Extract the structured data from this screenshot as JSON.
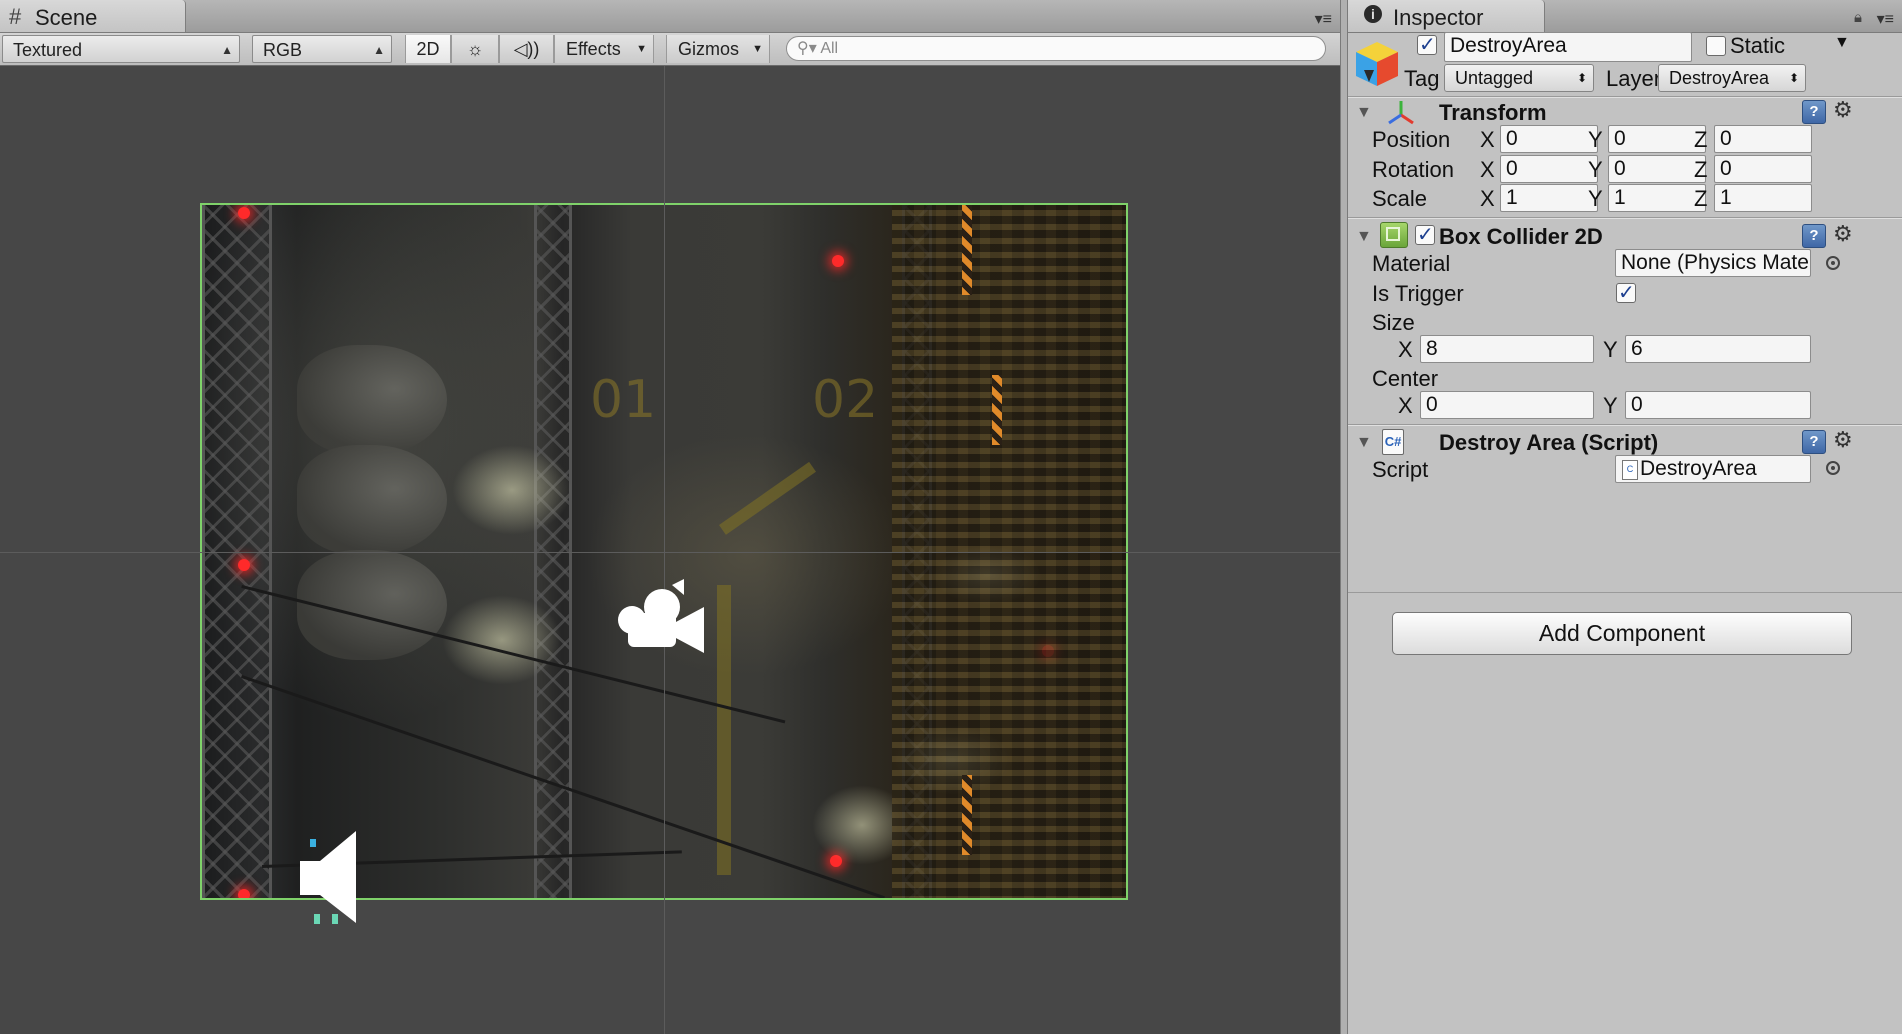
{
  "scene": {
    "tab_label": "Scene",
    "render_mode": "Textured",
    "color_mode": "RGB",
    "mode_2d": "2D",
    "effects": "Effects",
    "gizmos": "Gizmos",
    "search_placeholder": "All",
    "pad_labels": [
      "01",
      "02"
    ]
  },
  "inspector": {
    "tab_label": "Inspector",
    "object_name": "DestroyArea",
    "static_label": "Static",
    "tag_label": "Tag",
    "tag_value": "Untagged",
    "layer_label": "Layer",
    "layer_value": "DestroyArea",
    "transform": {
      "title": "Transform",
      "position_label": "Position",
      "rotation_label": "Rotation",
      "scale_label": "Scale",
      "axis_x": "X",
      "axis_y": "Y",
      "axis_z": "Z",
      "position": [
        "0",
        "0",
        "0"
      ],
      "rotation": [
        "0",
        "0",
        "0"
      ],
      "scale": [
        "1",
        "1",
        "1"
      ]
    },
    "box_collider": {
      "title": "Box Collider 2D",
      "material_label": "Material",
      "material_value": "None (Physics Materia",
      "is_trigger_label": "Is Trigger",
      "is_trigger": true,
      "size_label": "Size",
      "size": [
        "8",
        "6"
      ],
      "center_label": "Center",
      "center": [
        "0",
        "0"
      ]
    },
    "script_component": {
      "title": "Destroy Area (Script)",
      "script_label": "Script",
      "script_value": "DestroyArea"
    },
    "add_component": "Add Component"
  },
  "colors": {
    "collider_outline": "#7fd26a",
    "checkbox_check": "#1d3f8f",
    "help_icon": "#4f77b4"
  }
}
